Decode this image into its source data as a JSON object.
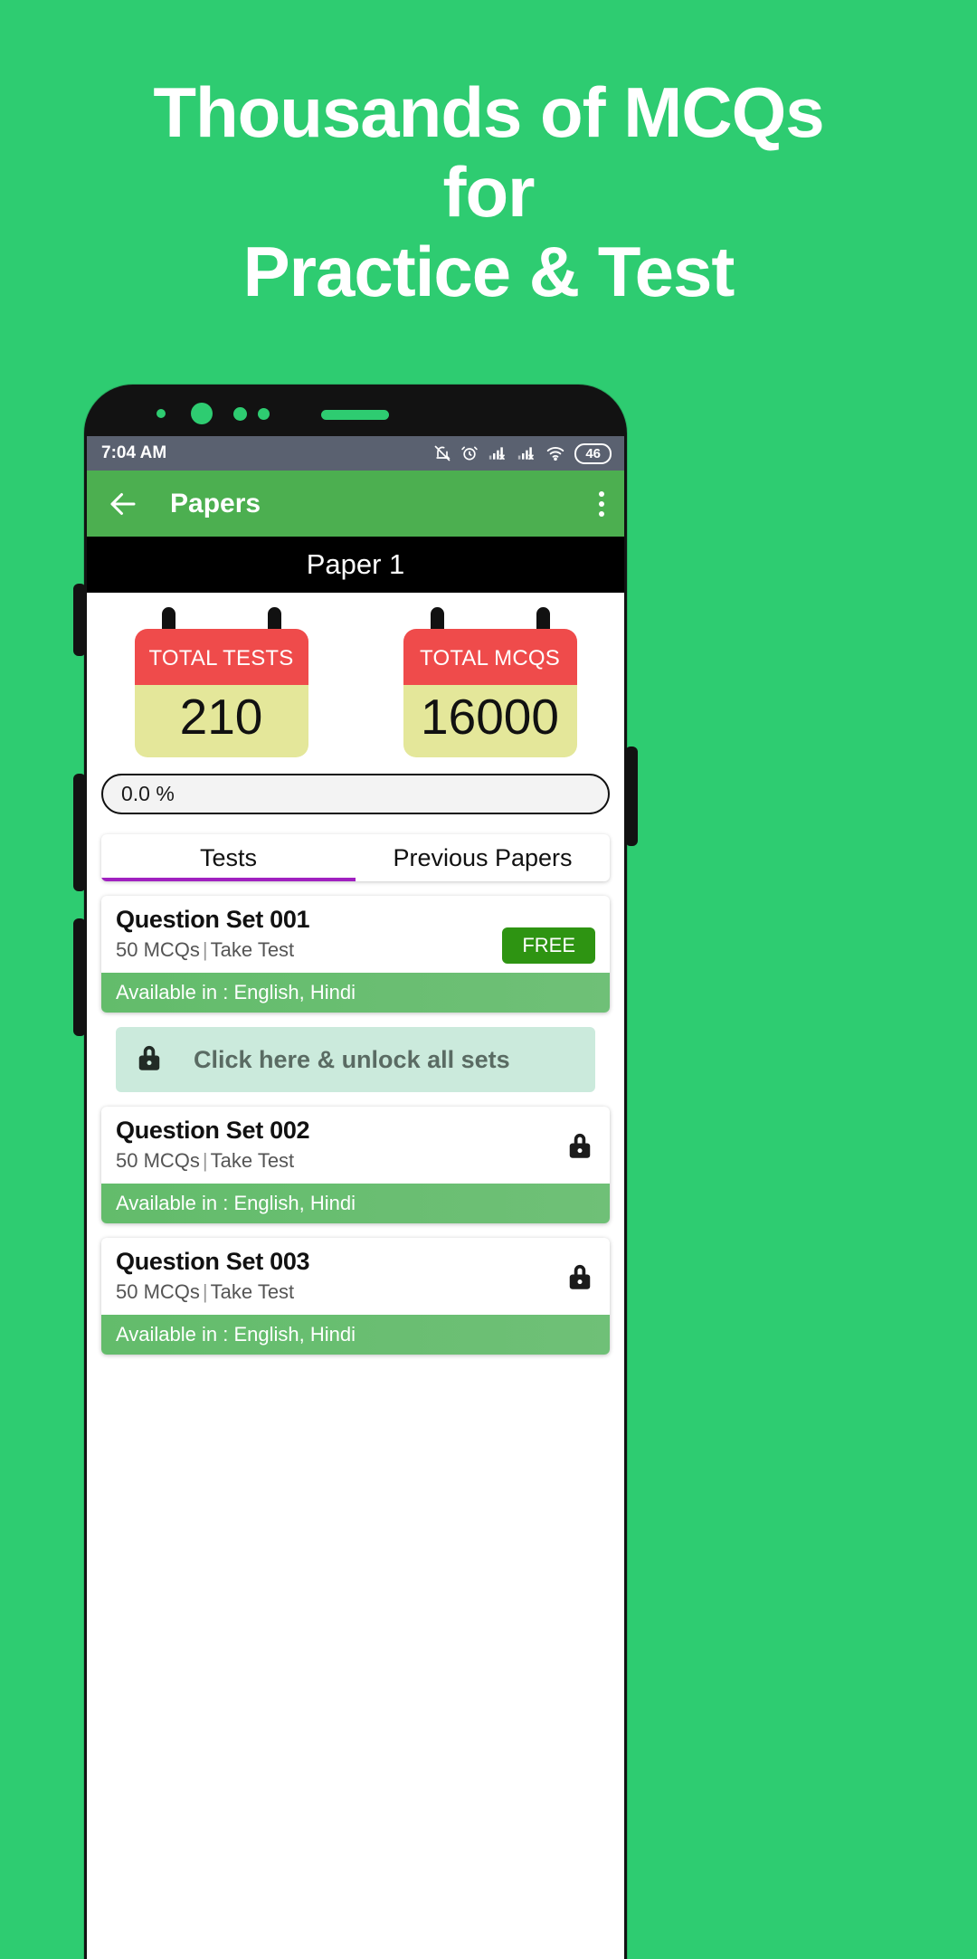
{
  "hero": {
    "line1": "Thousands of MCQs",
    "line2": "for",
    "line3": "Practice & Test"
  },
  "colors": {
    "background": "#2ECC71",
    "appbar": "#4CAF50",
    "calendar_head": "#EF4B4B",
    "calendar_body": "#E4E79A",
    "free_badge": "#2E9412",
    "tab_indicator": "#A020C0",
    "unlock_banner": "#CBEADC",
    "available_strip": "#63BC6B",
    "statusbar": "#5A6170"
  },
  "phone": {
    "statusbar": {
      "time": "7:04 AM",
      "icons": [
        "bell-off-icon",
        "alarm-icon",
        "signal-1-icon",
        "signal-2-icon",
        "wifi-icon"
      ],
      "battery": "46"
    },
    "appbar": {
      "back_icon": "arrow-left-icon",
      "title": "Papers",
      "menu_icon": "kebab-menu-icon"
    },
    "paper_strip": {
      "title": "Paper 1"
    },
    "stats": [
      {
        "label": "TOTAL TESTS",
        "value": "210"
      },
      {
        "label": "TOTAL MCQS",
        "value": "16000"
      }
    ],
    "progress": {
      "value": "0.0 %"
    },
    "tabs": [
      {
        "label": "Tests",
        "active": true
      },
      {
        "label": "Previous Papers",
        "active": false
      }
    ],
    "unlock_banner": {
      "icon": "lock-icon",
      "label": "Click here & unlock all sets"
    },
    "question_sets": [
      {
        "name": "Question Set 001",
        "mcqs": "50 MCQs",
        "separator": "|",
        "action": "Take Test",
        "badge": "FREE",
        "locked": false,
        "available": "Available in : English, Hindi"
      },
      {
        "name": "Question Set 002",
        "mcqs": "50 MCQs",
        "separator": "|",
        "action": "Take Test",
        "badge": "",
        "locked": true,
        "available": "Available in : English, Hindi"
      },
      {
        "name": "Question Set 003",
        "mcqs": "50 MCQs",
        "separator": "|",
        "action": "Take Test",
        "badge": "",
        "locked": true,
        "available": "Available in : English, Hindi"
      }
    ]
  }
}
